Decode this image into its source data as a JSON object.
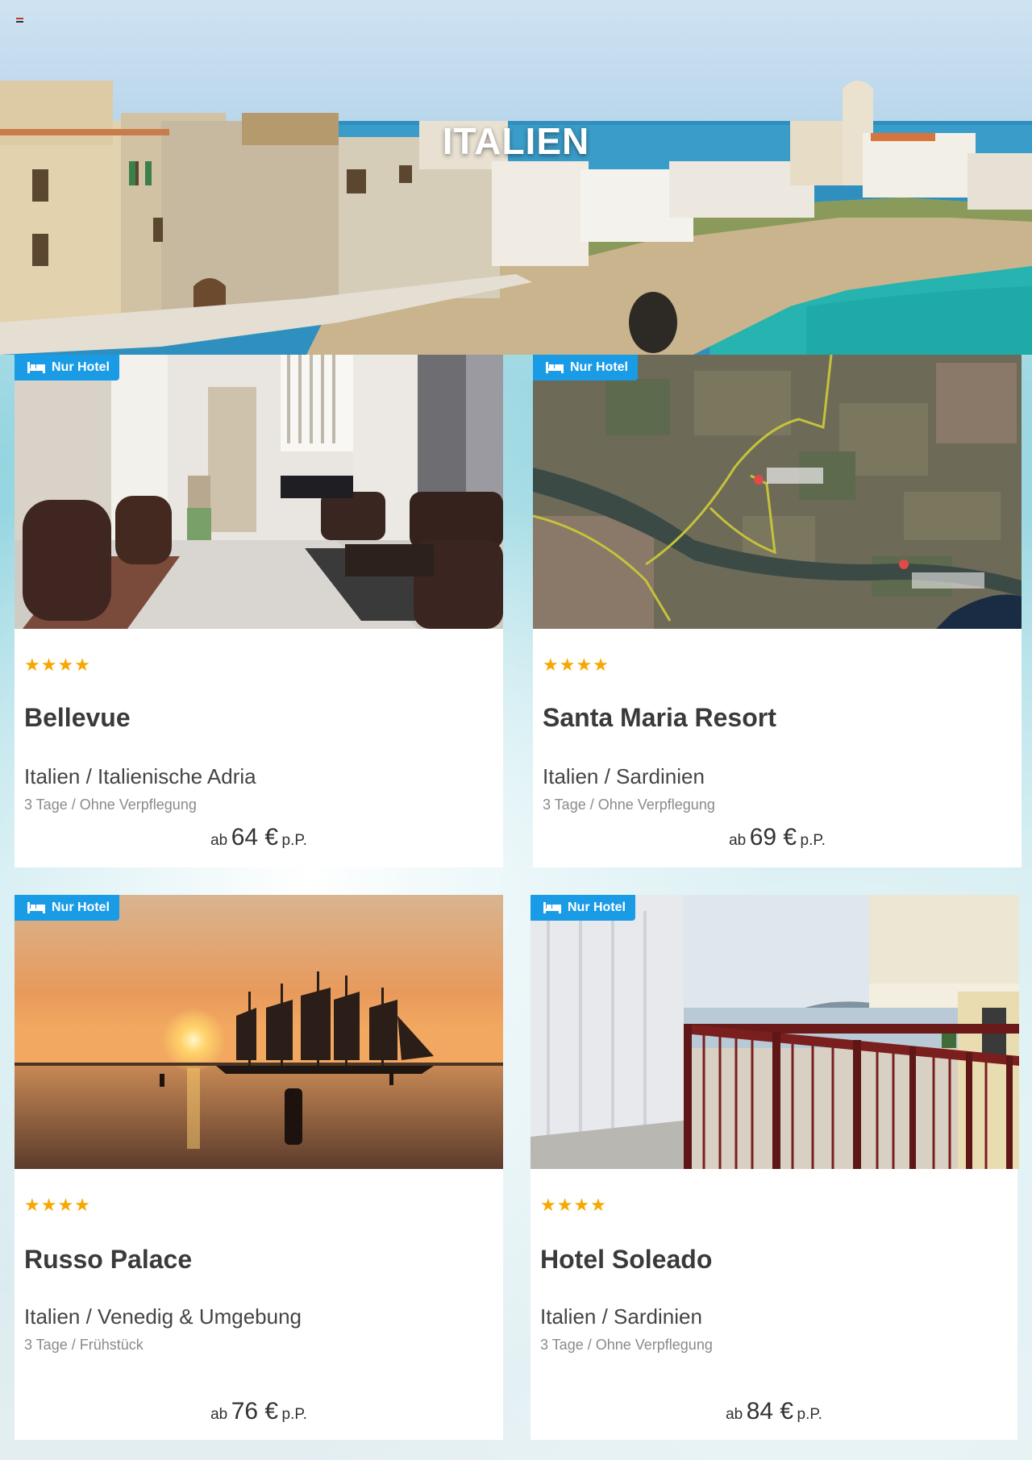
{
  "hero": {
    "title": "ITALIEN"
  },
  "badge_icon": "bed-icon",
  "hotels": [
    {
      "badge": "Nur Hotel",
      "stars": "★★★★",
      "stars_count": 4,
      "name": "Bellevue",
      "region": "Italien / Italienische Adria",
      "meta": "3 Tage / Ohne Verpflegung",
      "price_prefix": "ab",
      "price": "64 €",
      "price_suffix": "p.P."
    },
    {
      "badge": "Nur Hotel",
      "stars": "★★★★",
      "stars_count": 4,
      "name": "Santa Maria Resort",
      "region": "Italien / Sardinien",
      "meta": "3 Tage / Ohne Verpflegung",
      "price_prefix": "ab",
      "price": "69 €",
      "price_suffix": "p.P."
    },
    {
      "badge": "Nur Hotel",
      "stars": "★★★★",
      "stars_count": 4,
      "name": "Russo Palace",
      "region": "Italien / Venedig & Umgebung",
      "meta": "3 Tage / Frühstück",
      "price_prefix": "ab",
      "price": "76 €",
      "price_suffix": "p.P."
    },
    {
      "badge": "Nur Hotel",
      "stars": "★★★★",
      "stars_count": 4,
      "name": "Hotel Soleado",
      "region": "Italien / Sardinien",
      "meta": "3 Tage / Ohne Verpflegung",
      "price_prefix": "ab",
      "price": "84 €",
      "price_suffix": "p.P."
    }
  ],
  "colors": {
    "badge": "#1a9be6",
    "stars": "#f6a800",
    "name": "#3a3a3a"
  }
}
